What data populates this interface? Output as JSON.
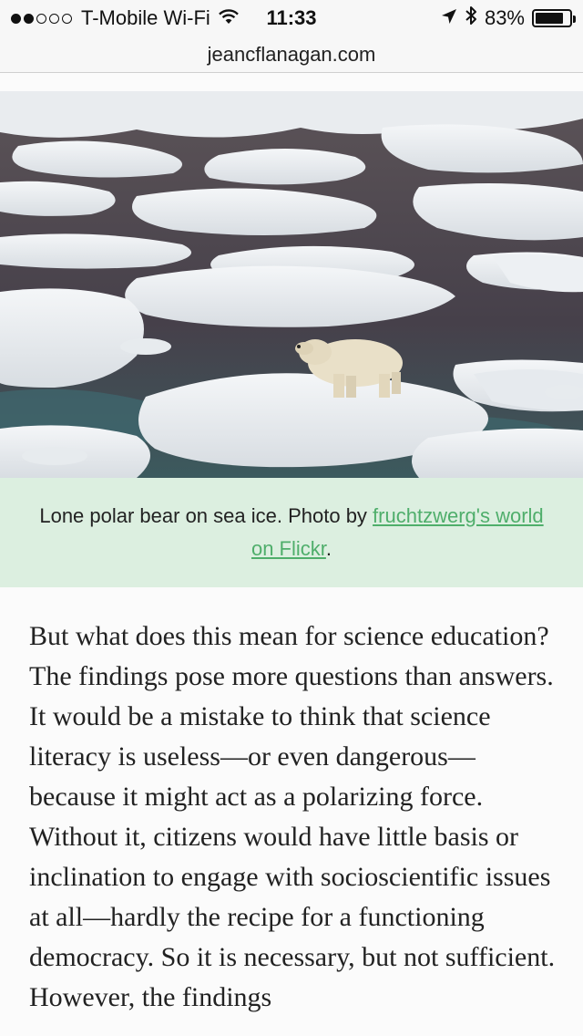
{
  "status_bar": {
    "carrier": "T-Mobile Wi-Fi",
    "time": "11:33",
    "battery_percent": "83%",
    "battery_level": 0.83,
    "signal_bars": 2,
    "icons": [
      "signal-dots-icon",
      "wifi-icon",
      "location-arrow-icon",
      "bluetooth-icon",
      "battery-icon"
    ]
  },
  "browser": {
    "domain": "jeancflanagan.com"
  },
  "photo": {
    "description_icon": "polar-bear-photo"
  },
  "caption": {
    "text_before": "Lone polar bear on sea ice. Photo by ",
    "link_text": "fruchtzwerg's world on Flickr",
    "text_after": "."
  },
  "article": {
    "paragraph": "But what does this mean for science education? The findings pose more questions than answers. It would be a mistake to think that science literacy is useless—or even dangerous—because it might act as a polarizing force. Without it, citizens would have little basis or inclination to engage with socioscientific issues at all—hardly the recipe for a functioning democracy. So it is necessary, but not sufficient. However, the findings"
  },
  "colors": {
    "caption_bg": "#dcefe0",
    "link": "#4fae6b",
    "page_bg": "#fbfbfb",
    "text": "#222222"
  }
}
